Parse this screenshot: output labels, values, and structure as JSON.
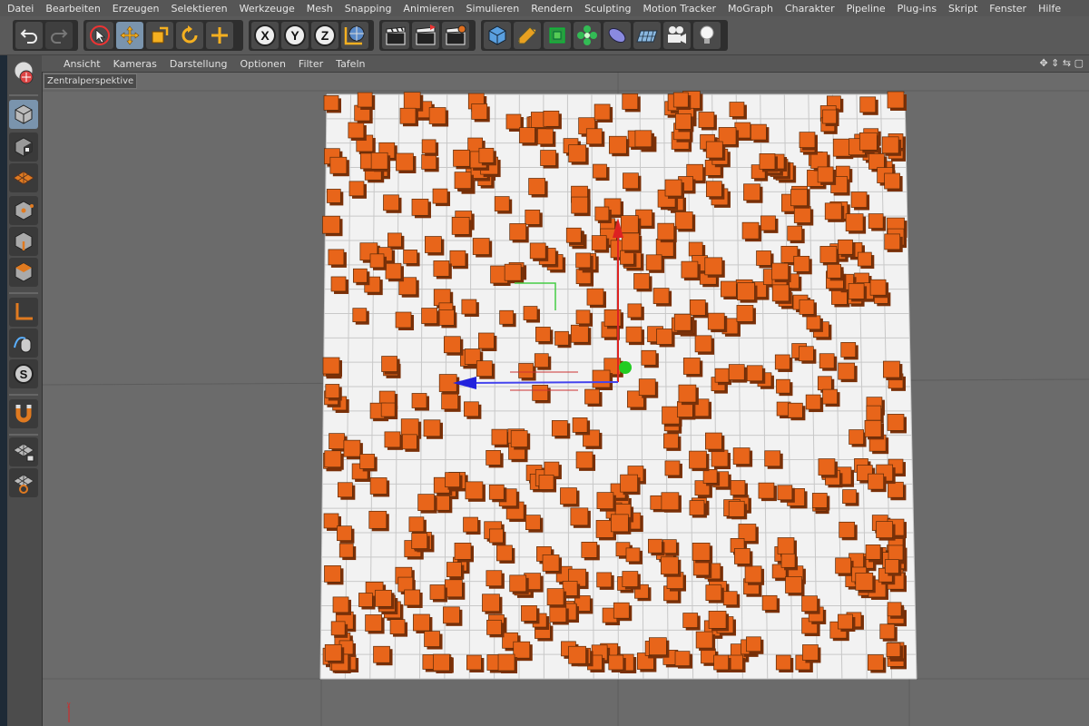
{
  "menubar": {
    "items": [
      "Datei",
      "Bearbeiten",
      "Erzeugen",
      "Selektieren",
      "Werkzeuge",
      "Mesh",
      "Snapping",
      "Animieren",
      "Simulieren",
      "Rendern",
      "Sculpting",
      "Motion Tracker",
      "MoGraph",
      "Charakter",
      "Pipeline",
      "Plug-ins",
      "Skript",
      "Fenster",
      "Hilfe"
    ]
  },
  "toolbar": {
    "axis_x": "X",
    "axis_y": "Y",
    "axis_z": "Z"
  },
  "viewport_menu": {
    "items": [
      "Ansicht",
      "Kameras",
      "Darstellung",
      "Optionen",
      "Filter",
      "Tafeln"
    ],
    "nav_icons": "✥ ⇕ ⇆ ▢"
  },
  "viewport": {
    "label": "Zentralperspektive",
    "background_color": "#6b6b6b",
    "plane_color": "#f2f2f2",
    "grid_color": "#c8c8c8",
    "cube_color": "#e8651a",
    "cube_shadow": "#7a3008"
  },
  "colors": {
    "accent": "#7a94ad",
    "gizmo_x": "#d22",
    "gizmo_y": "#2c2",
    "gizmo_z": "#22d"
  }
}
